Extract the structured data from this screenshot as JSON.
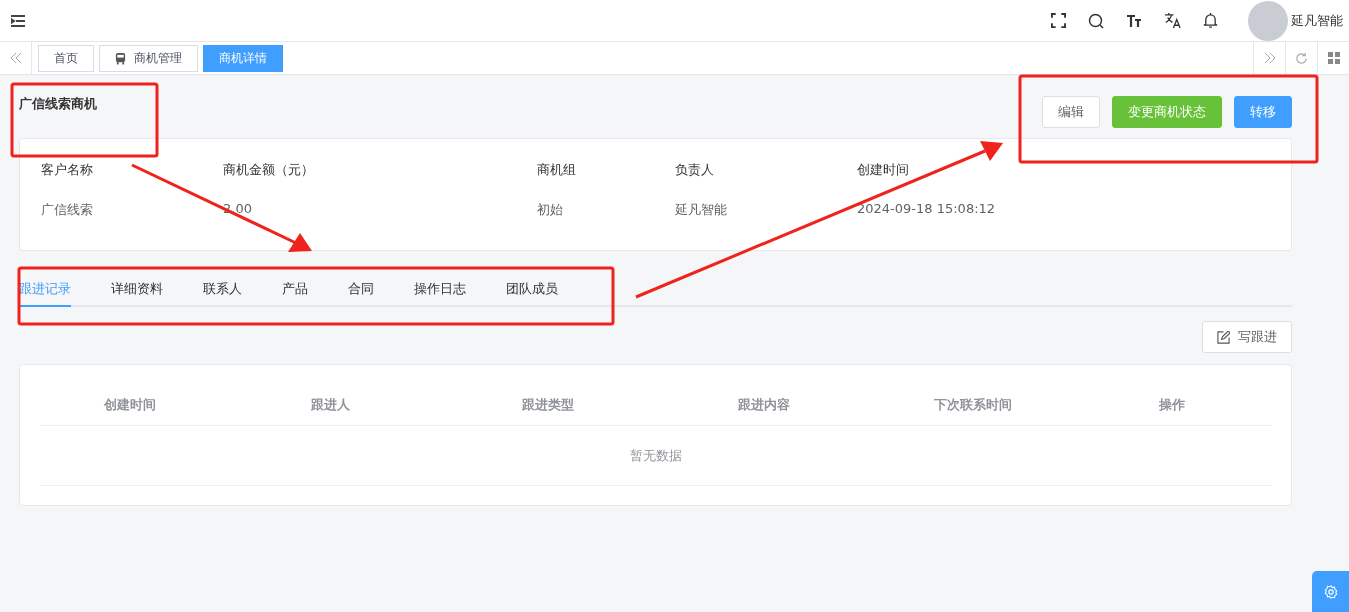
{
  "header": {
    "user_name": "延凡智能"
  },
  "tags": [
    {
      "label": "首页",
      "selected": false,
      "icon": false
    },
    {
      "label": "商机管理",
      "selected": false,
      "icon": true
    },
    {
      "label": "商机详情",
      "selected": true,
      "icon": false
    }
  ],
  "page": {
    "title": "广信线索商机",
    "actions": [
      {
        "label": "编辑",
        "kind": "default"
      },
      {
        "label": "变更商机状态",
        "kind": "success"
      },
      {
        "label": "转移",
        "kind": "primary"
      }
    ]
  },
  "info": [
    {
      "label": "客户名称",
      "value": "广信线索"
    },
    {
      "label": "商机金额（元）",
      "value": "2.00"
    },
    {
      "label": "商机组",
      "value": "初始"
    },
    {
      "label": "负责人",
      "value": "延凡智能"
    },
    {
      "label": "创建时间",
      "value": "2024-09-18 15:08:12"
    }
  ],
  "tabs": [
    {
      "label": "跟进记录",
      "selected": true
    },
    {
      "label": "详细资料",
      "selected": false
    },
    {
      "label": "联系人",
      "selected": false
    },
    {
      "label": "产品",
      "selected": false
    },
    {
      "label": "合同",
      "selected": false
    },
    {
      "label": "操作日志",
      "selected": false
    },
    {
      "label": "团队成员",
      "selected": false
    }
  ],
  "write_button": "写跟进",
  "table": {
    "columns": [
      "创建时间",
      "跟进人",
      "跟进类型",
      "跟进内容",
      "下次联系时间",
      "操作"
    ],
    "empty_text": "暂无数据"
  }
}
